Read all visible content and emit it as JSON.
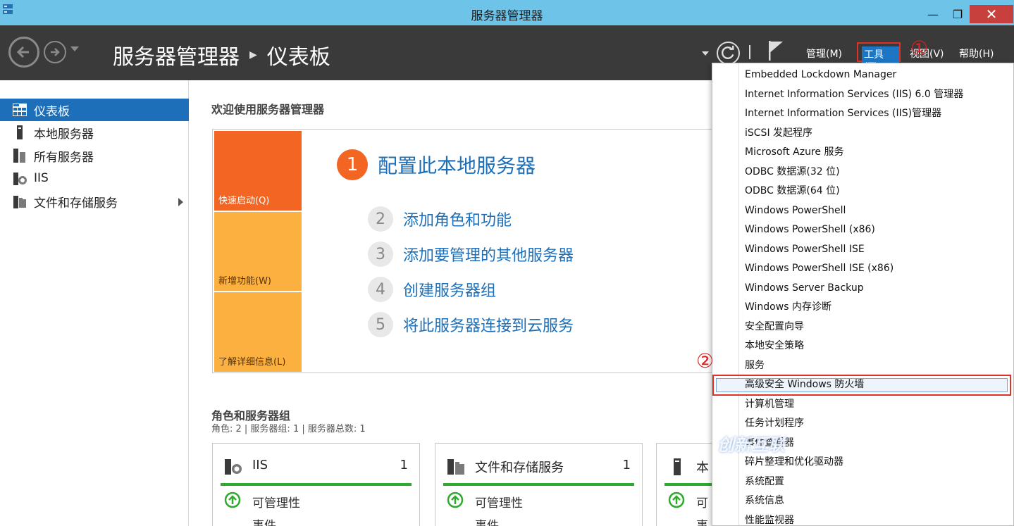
{
  "window": {
    "title": "服务器管理器"
  },
  "header": {
    "breadcrumb_root": "服务器管理器",
    "breadcrumb_current": "仪表板",
    "menus": {
      "manage": "管理(M)",
      "tools": "工具(T)",
      "view": "视图(V)",
      "help": "帮助(H)"
    }
  },
  "annotations": {
    "first": "①",
    "second": "②"
  },
  "sidebar": {
    "items": [
      {
        "label": "仪表板",
        "active": true
      },
      {
        "label": "本地服务器"
      },
      {
        "label": "所有服务器"
      },
      {
        "label": "IIS"
      },
      {
        "label": "文件和存储服务"
      }
    ]
  },
  "main": {
    "welcome_title": "欢迎使用服务器管理器",
    "tiles": [
      "快速启动(Q)",
      "新增功能(W)",
      "了解详细信息(L)"
    ],
    "steps": [
      {
        "num": "1",
        "label": "配置此本地服务器"
      },
      {
        "num": "2",
        "label": "添加角色和功能"
      },
      {
        "num": "3",
        "label": "添加要管理的其他服务器"
      },
      {
        "num": "4",
        "label": "创建服务器组"
      },
      {
        "num": "5",
        "label": "将此服务器连接到云服务"
      }
    ],
    "roles_title": "角色和服务器组",
    "roles_sub": "角色: 2 | 服务器组: 1 | 服务器总数: 1",
    "cards": [
      {
        "title": "IIS",
        "count": "1",
        "manageability": "可管理性",
        "events": "事件"
      },
      {
        "title": "文件和存储服务",
        "count": "1",
        "manageability": "可管理性",
        "events": "事件"
      },
      {
        "title": "本",
        "count": "",
        "manageability": "可",
        "events": "事"
      }
    ]
  },
  "tools_menu": {
    "items": [
      "Embedded Lockdown Manager",
      "Internet Information Services (IIS) 6.0 管理器",
      "Internet Information Services (IIS)管理器",
      "iSCSI 发起程序",
      "Microsoft Azure 服务",
      "ODBC 数据源(32 位)",
      "ODBC 数据源(64 位)",
      "Windows PowerShell",
      "Windows PowerShell (x86)",
      "Windows PowerShell ISE",
      "Windows PowerShell ISE (x86)",
      "Windows Server Backup",
      "Windows 内存诊断",
      "安全配置向导",
      "本地安全策略",
      "服务",
      "高级安全 Windows 防火墙",
      "计算机管理",
      "任务计划程序",
      "事件查看器",
      "碎片整理和优化驱动器",
      "系统配置",
      "系统信息",
      "性能监视器"
    ],
    "highlighted_index": 16
  },
  "watermark": "创新互联",
  "colors": {
    "accent": "#1c6fb8",
    "orange": "#f26522",
    "amber": "#fbb040",
    "header": "#3a3a3a",
    "titlebar": "#6ec3e8",
    "highlight_border": "#e0302a",
    "ok_green": "#2eaa2e"
  }
}
